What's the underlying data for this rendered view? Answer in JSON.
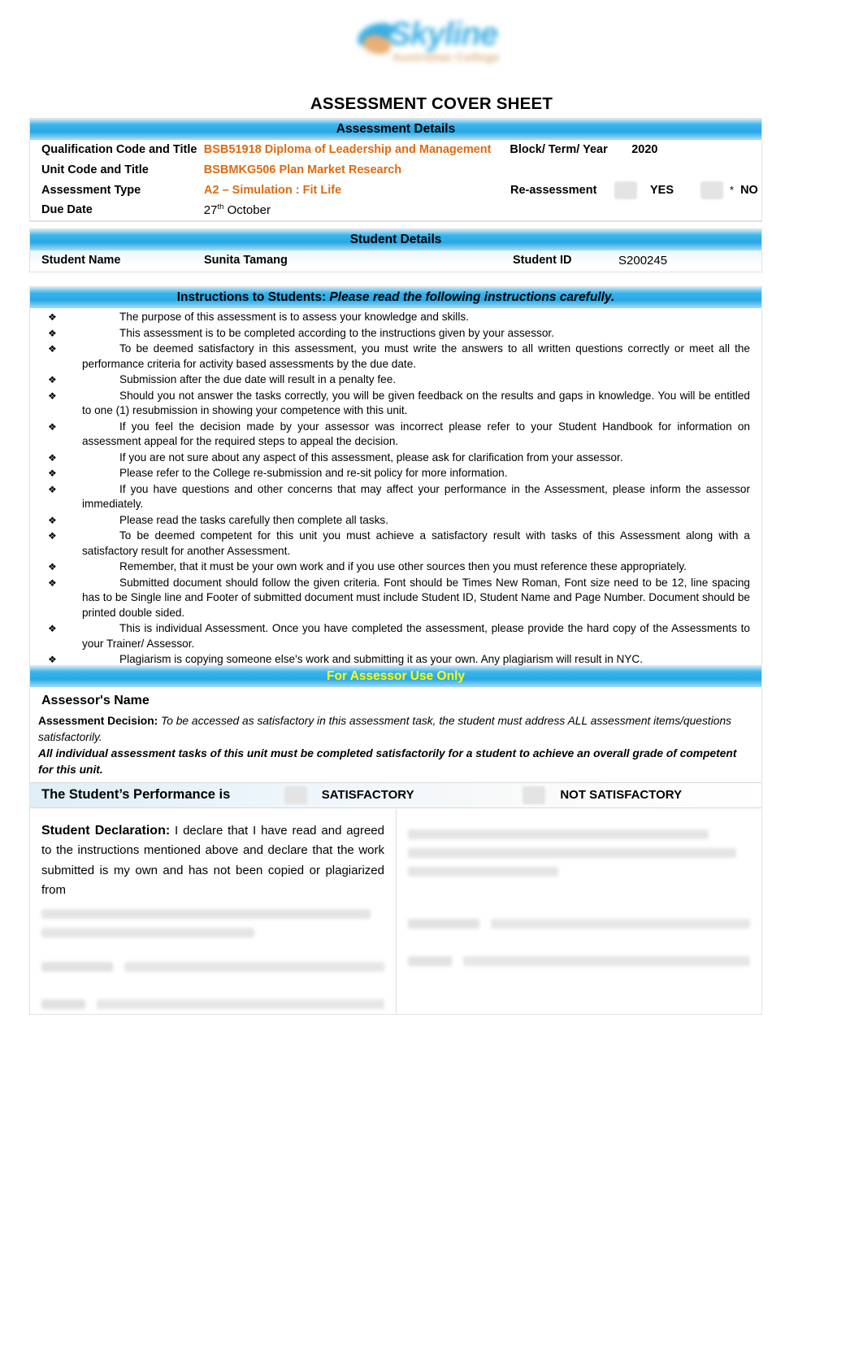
{
  "logo": {
    "name": "skyline-logo",
    "word": "Skyline",
    "tagline": "Australian College"
  },
  "document": {
    "title": "ASSESSMENT COVER SHEET"
  },
  "assessment_details": {
    "band_title": "Assessment Details",
    "qualification_label": "Qualification Code and Title",
    "qualification_value": "BSB51918 Diploma of Leadership and Management",
    "block_term_year_label": "Block/ Term/ Year",
    "block_term_year_value": "2020",
    "unit_label": "Unit Code and Title",
    "unit_value": "BSBMKG506 Plan Market Research",
    "type_label": "Assessment Type",
    "type_value": "A2 – Simulation : Fit Life",
    "reassessment_label": "Re-assessment",
    "reassessment_yes": "YES",
    "reassessment_no": "NO",
    "reassessment_marker": "*",
    "due_date_label": "Due Date",
    "due_date_day": "27",
    "due_date_suffix": "th",
    "due_date_month": "October"
  },
  "student_details": {
    "band_title": "Student Details",
    "name_label": "Student Name",
    "name_value": "Sunita Tamang",
    "id_label": "Student ID",
    "id_value": "S200245"
  },
  "instructions": {
    "band_title_bold": "Instructions to Students:",
    "band_title_italic": " Please read the following instructions carefully.",
    "bullet_glyph": "❖",
    "items": [
      "The purpose of this assessment is to assess your knowledge and skills.",
      "This assessment is to be completed according to the instructions given by your assessor.",
      "To be deemed satisfactory in this assessment, you must write the answers to all written questions correctly or meet all the performance criteria for activity based assessments by the due date.",
      "Submission after the due date will result in a penalty fee.",
      "Should you not answer the tasks correctly, you will be given feedback on the results and gaps in knowledge. You will be entitled to one (1) resubmission in showing your competence with this unit.",
      "If you feel the decision made by your assessor was incorrect please refer to your Student Handbook for information on assessment appeal for the required steps to appeal the decision.",
      "If you are not sure about any aspect of this assessment, please ask for clarification from your assessor.",
      "Please refer to the College re-submission and re-sit policy for more information.",
      "If you have questions and other concerns that may affect your performance in the Assessment, please inform the assessor immediately.",
      "Please read the tasks carefully then complete all tasks.",
      "To be deemed competent for this unit you must achieve a satisfactory result with tasks of this Assessment along with a satisfactory result for another Assessment.",
      "Remember, that it must be your own work and if you use other sources then you must reference these appropriately.",
      "Submitted document should follow the given criteria. Font should be Times New Roman, Font size need to be 12, line spacing has to be Single line and Footer of submitted document must include Student ID, Student Name and Page Number. Document should be printed double sided.",
      "This is individual Assessment. Once you have completed the assessment, please provide the hard copy of the Assessments to your Trainer/ Assessor.",
      "Plagiarism is copying someone else's work and submitting it as your own. Any plagiarism will result in NYC."
    ]
  },
  "assessor": {
    "band_title": "For Assessor Use Only",
    "name_label": "Assessor's Name",
    "decision_label": "Assessment Decision:",
    "decision_text": " To be accessed as satisfactory in this assessment task, the student must address ALL assessment items/questions satisfactorily.",
    "overall_note": "All individual assessment tasks of this unit must be completed satisfactorily for a student to achieve an overall grade of competent for this unit.",
    "performance_label": "The Student’s Performance is",
    "option_satisfactory": "SATISFACTORY",
    "option_not_satisfactory": "NOT SATISFACTORY"
  },
  "declaration": {
    "student_title": "Student Declaration:",
    "student_text": " I declare that I have read and agreed to the instructions mentioned above and declare that the work submitted is my own and has not been copied or plagiarized from"
  },
  "colors": {
    "band_blue": "#27a8e5",
    "accent_orange": "#e06a10",
    "band_yellow_text": "#ffff00",
    "text_black": "#000000"
  }
}
